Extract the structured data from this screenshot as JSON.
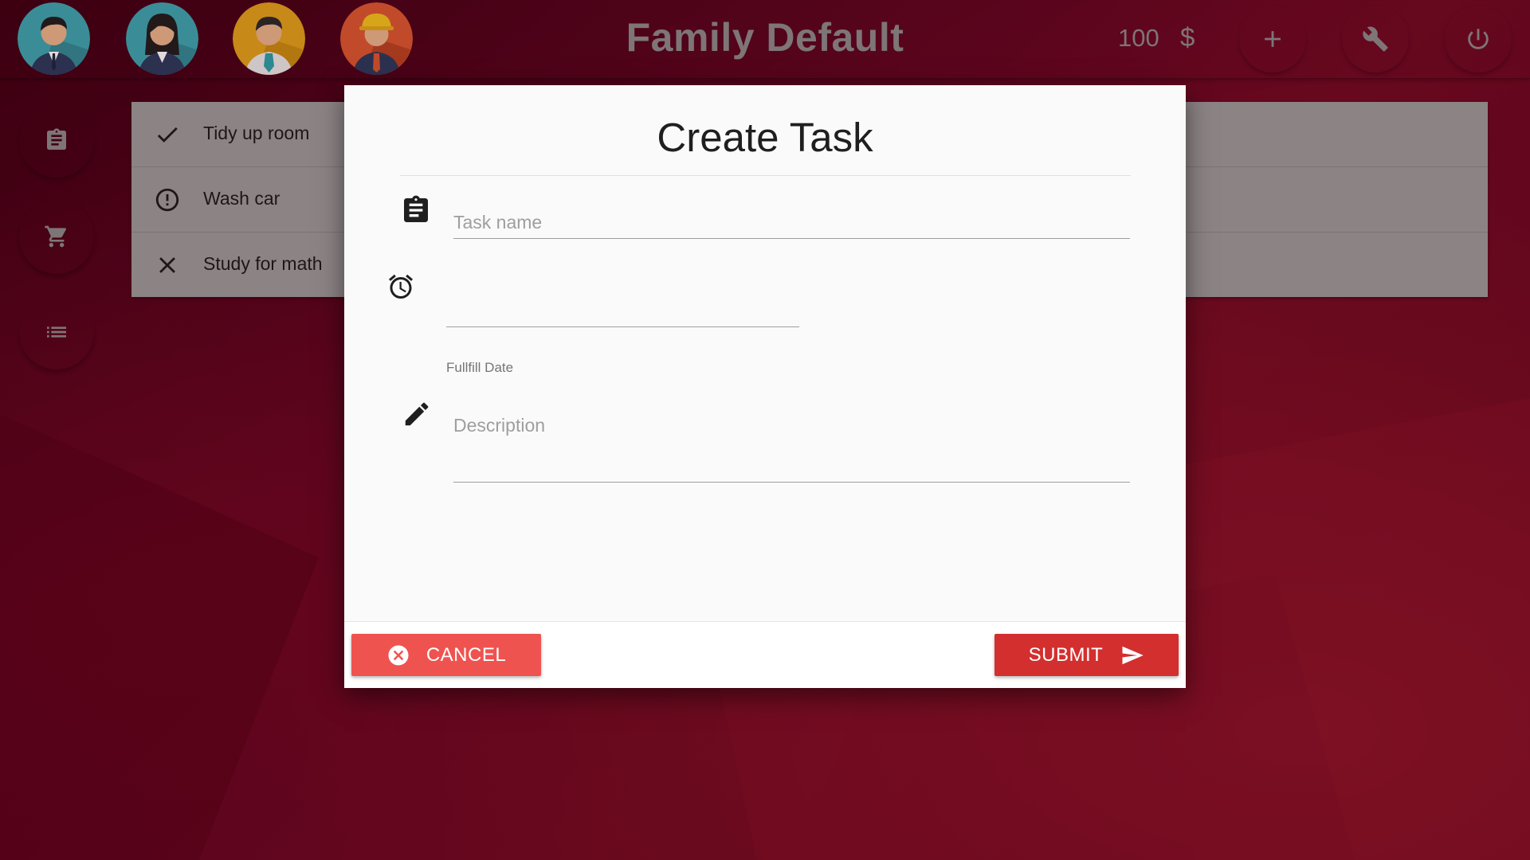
{
  "header": {
    "title": "Family Default",
    "balance": "100",
    "currency": "$",
    "avatars": [
      {
        "name": "avatar-man-dark-hair",
        "bg": "#3aa6b0"
      },
      {
        "name": "avatar-woman",
        "bg": "#3aa6b0"
      },
      {
        "name": "avatar-man-teal-tie",
        "bg": "#e0a21a"
      },
      {
        "name": "avatar-worker-hardhat",
        "bg": "#d9572f"
      }
    ],
    "actions": [
      "add-icon",
      "wrench-icon",
      "power-icon"
    ]
  },
  "sidebar": {
    "items": [
      "clipboard-icon",
      "cart-icon",
      "list-icon"
    ]
  },
  "tasks": [
    {
      "label": "Tidy up room",
      "status": "done",
      "icon": "check-icon"
    },
    {
      "label": "Wash car",
      "status": "pending",
      "icon": "alert-circle-icon"
    },
    {
      "label": "Study for math",
      "status": "failed",
      "icon": "close-icon"
    }
  ],
  "modal": {
    "title": "Create Task",
    "task_name_placeholder": "Task name",
    "task_name_value": "",
    "date_label": "Fullfill Date",
    "date_value": "",
    "description_placeholder": "Description",
    "description_value": "",
    "cancel_label": "CANCEL",
    "submit_label": "SUBMIT"
  },
  "colors": {
    "background": "#5e0520",
    "cancel_button": "#ef5350",
    "submit_button": "#d32f2f",
    "task_list_bg": "#9b9b9b"
  }
}
